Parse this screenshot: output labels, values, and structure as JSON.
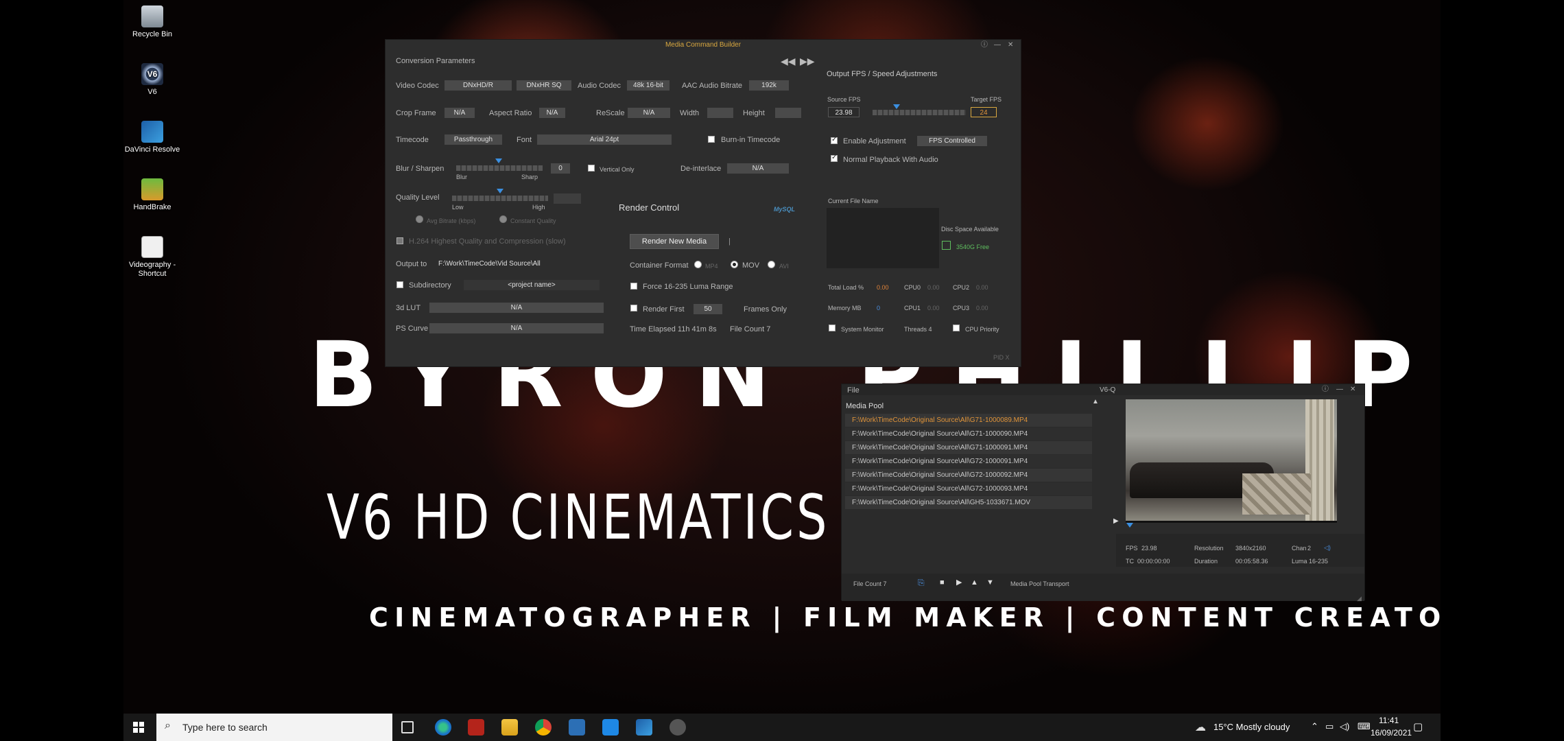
{
  "desktop": {
    "icons": [
      {
        "label": "Recycle Bin"
      },
      {
        "label": "V6"
      },
      {
        "label": "DaVinci Resolve"
      },
      {
        "label": "HandBrake"
      },
      {
        "label": "Videography - Shortcut"
      }
    ],
    "name_text": "BYRON PHILLIPS",
    "subtitle": "V6 HD CINEMATICS",
    "tagline": "CINEMATOGRAPHER | FILM MAKER | CONTENT CREATOR"
  },
  "mcb": {
    "title": "Media Command Builder",
    "conversion_parameters": "Conversion Parameters",
    "video_codec_label": "Video Codec",
    "video_codec": "DNxHD/R",
    "video_codec_profile": "DNxHR SQ",
    "audio_codec_label": "Audio Codec",
    "audio_codec": "48k 16-bit",
    "aac_label": "AAC Audio Bitrate",
    "aac_value": "192k",
    "crop_label": "Crop Frame",
    "crop_value": "N/A",
    "aspect_label": "Aspect Ratio",
    "aspect_value": "N/A",
    "rescale_label": "ReScale",
    "rescale_value": "N/A",
    "width_label": "Width",
    "height_label": "Height",
    "timecode_label": "Timecode",
    "timecode_value": "Passthrough",
    "font_label": "Font",
    "font_value": "Arial 24pt",
    "burnin_label": "Burn-in Timecode",
    "blur_label": "Blur / Sharpen",
    "blur_value": "0",
    "blur_low": "Blur",
    "blur_high": "Sharp",
    "vertical_only": "Vertical Only",
    "deinterlace_label": "De-interlace",
    "deinterlace_value": "N/A",
    "quality_label": "Quality Level",
    "quality_low": "Low",
    "quality_high": "High",
    "avg_bitrate": "Avg Bitrate (kbps)",
    "constant_quality": "Constant Quality",
    "h264_label": "H.264 Highest Quality and Compression (slow)",
    "output_label": "Output to",
    "output_value": "F:\\Work\\TimeCode\\Vid Source\\All",
    "subdirectory_label": "Subdirectory",
    "subdirectory_value": "<project name>",
    "lut_label": "3d LUT",
    "lut_value": "N/A",
    "ps_label": "PS Curve",
    "ps_value": "N/A",
    "render_control": "Render Control",
    "mysql_logo": "MySQL",
    "render_button": "Render New Media",
    "container_label": "Container Format",
    "container_options": [
      "MP4",
      "MOV",
      "AVI"
    ],
    "force_luma": "Force 16-235 Luma Range",
    "render_first_label": "Render First",
    "render_first_value": "50",
    "frames_only": "Frames Only",
    "time_elapsed": "Time Elapsed  11h 41m 8s",
    "file_count": "File Count  7",
    "fps_header": "Output FPS / Speed Adjustments",
    "source_fps_label": "Source FPS",
    "source_fps": "23.98",
    "target_fps_label": "Target FPS",
    "target_fps": "24",
    "enable_adjustment": "Enable Adjustment",
    "fps_controlled": "FPS Controlled",
    "normal_playback": "Normal Playback With Audio",
    "current_file": "Current File Name",
    "disc_space_label": "Disc Space Available",
    "disc_space_value": "3540G Free",
    "total_load_label": "Total Load %",
    "total_load_value": "0.00",
    "cpu0_label": "CPU0",
    "cpu0_value": "0.00",
    "cpu2_label": "CPU2",
    "cpu2_value": "0.00",
    "memory_label": "Memory MB",
    "memory_value": "0",
    "cpu1_label": "CPU1",
    "cpu1_value": "0.00",
    "cpu3_label": "CPU3",
    "cpu3_value": "0.00",
    "system_monitor": "System Monitor",
    "threads": "Threads 4",
    "cpu_priority": "CPU Priority",
    "pid": "PID X",
    "accent_color": "#d9a840"
  },
  "v6q": {
    "menu_file": "File",
    "title": "V6-Q",
    "media_pool": "Media Pool",
    "files": [
      "F:\\Work\\TimeCode\\Original Source\\All\\G71-1000089.MP4",
      "F:\\Work\\TimeCode\\Original Source\\All\\G71-1000090.MP4",
      "F:\\Work\\TimeCode\\Original Source\\All\\G71-1000091.MP4",
      "F:\\Work\\TimeCode\\Original Source\\All\\G72-1000091.MP4",
      "F:\\Work\\TimeCode\\Original Source\\All\\G72-1000092.MP4",
      "F:\\Work\\TimeCode\\Original Source\\All\\G72-1000093.MP4",
      "F:\\Work\\TimeCode\\Original Source\\All\\GH5-1033671.MOV"
    ],
    "file_count": "File Count  7",
    "transport_label": "Media Pool Transport",
    "fps_label": "FPS",
    "fps_value": "23.98",
    "resolution_label": "Resolution",
    "resolution_value": "3840x2160",
    "chan_label": "Chan",
    "chan_value": "2",
    "tc_label": "TC",
    "tc_value": "00:00:00:00",
    "duration_label": "Duration",
    "duration_value": "00:05:58.36",
    "luma_label": "Luma",
    "luma_value": "16-235"
  },
  "taskbar": {
    "search_placeholder": "Type here to search",
    "weather": "15°C  Mostly cloudy",
    "time": "11:41",
    "date": "16/09/2021"
  }
}
